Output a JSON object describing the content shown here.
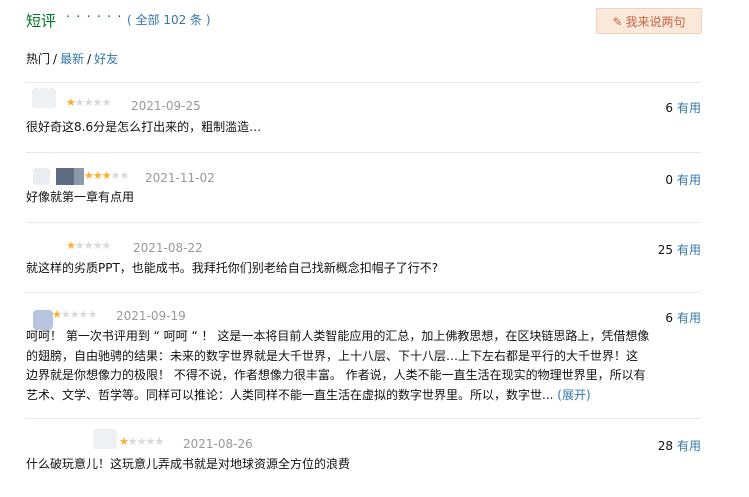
{
  "header": {
    "title": "短评",
    "dots": "· · · · · ·",
    "count_prefix": "( 全部 ",
    "count_number": "102",
    "count_suffix": " 条 )",
    "write_button": "我来说两句",
    "write_icon": "pencil-icon"
  },
  "filters": {
    "hot": "热门",
    "latest": "最新",
    "friends": "好友",
    "separator": "/"
  },
  "comments": [
    {
      "rating": 1,
      "date": "2021-09-25",
      "votes": "6",
      "useful_label": "有用",
      "text": "很好奇这8.6分是怎么打出来的，粗制滥造…"
    },
    {
      "rating": 3,
      "date": "2021-11-02",
      "votes": "0",
      "useful_label": "有用",
      "text": "好像就第一章有点用"
    },
    {
      "rating": 1,
      "date": "2021-08-22",
      "votes": "25",
      "useful_label": "有用",
      "text": "就这样的劣质PPT，也能成书。我拜托你们别老给自己找新概念扣帽子了行不?"
    },
    {
      "rating": 1,
      "date": "2021-09-19",
      "votes": "6",
      "useful_label": "有用",
      "text_lines": [
        "呵呵！ 第一次书评用到 “ 呵呵 “ ！ 这是一本将目前人类智能应用的汇总，加上佛教思想，在区块链思路上，凭借想像",
        "的翅膀，自由驰骋的结果：未来的数字世界就是大千世界，上十八层、下十八层…上下左右都是平行的大千世界！这",
        "边界就是你想像力的极限！ 不得不说，作者想像力很丰富。 作者说，人类不能一直生活在现实的物理世界里，所以有",
        "艺术、文学、哲学等。同样可以推论：人类同样不能一直生活在虚拟的数字世界里。所以，数字世... "
      ],
      "expand_label": "(展开)"
    },
    {
      "rating": 1,
      "date": "2021-08-26",
      "votes": "28",
      "useful_label": "有用",
      "text": "什么破玩意儿！这玩意儿弄成书就是对地球资源全方位的浪费"
    }
  ]
}
